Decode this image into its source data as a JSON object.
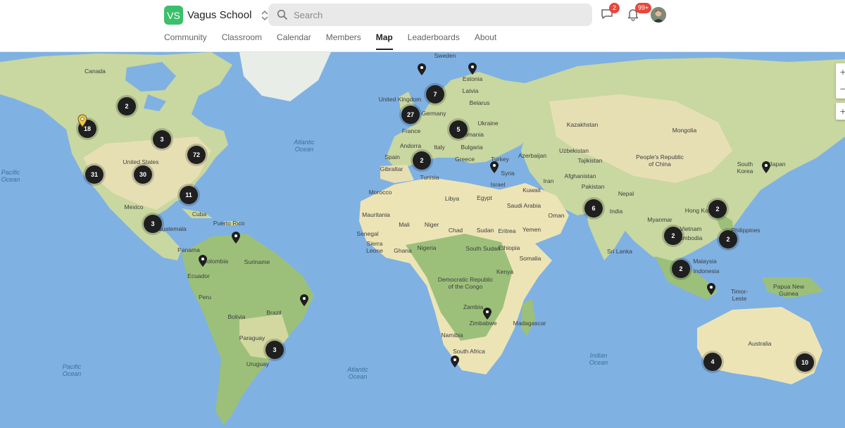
{
  "brand": {
    "initials": "VS",
    "name": "Vagus School"
  },
  "search": {
    "placeholder": "Search"
  },
  "notifications": {
    "chat_count": "2",
    "alerts_count": "99+"
  },
  "nav": {
    "tabs": [
      "Community",
      "Classroom",
      "Calendar",
      "Members",
      "Map",
      "Leaderboards",
      "About"
    ],
    "active": "Map"
  },
  "map": {
    "countries": [
      "Canada",
      "United States",
      "Mexico",
      "Cuba",
      "Guatemala",
      "Puerto Rico",
      "Panama",
      "Colombia",
      "Suriname",
      "Ecuador",
      "Peru",
      "Bolivia",
      "Brazil",
      "Paraguay",
      "Uruguay",
      "Sweden",
      "Estonia",
      "Latvia",
      "Belarus",
      "United Kingdom",
      "Germany",
      "France",
      "Ukraine",
      "Romania",
      "Andorra",
      "Italy",
      "Bulgaria",
      "Spain",
      "Greece",
      "Gibraltar",
      "Turkey",
      "Tunisia",
      "Syria",
      "Israel",
      "Morocco",
      "Libya",
      "Egypt",
      "Mauritania",
      "Mali",
      "Niger",
      "Chad",
      "Sudan",
      "Eritrea",
      "Senegal",
      "Sierra Leone",
      "Ghana",
      "Nigeria",
      "South Sudan",
      "Ethiopia",
      "Somalia",
      "Kenya",
      "Democratic Republic of the Congo",
      "Zambia",
      "Zimbabwe",
      "Madagascar",
      "Namibia",
      "South Africa",
      "Kazakhstan",
      "Mongolia",
      "Uzbekistan",
      "Tajikistan",
      "People's Republic of China",
      "Azerbaijan",
      "Iran",
      "Afghanistan",
      "Pakistan",
      "Kuwait",
      "Saudi Arabia",
      "Oman",
      "Yemen",
      "Nepal",
      "India",
      "Sri Lanka",
      "Myanmar",
      "Hong Kong",
      "Vietnam",
      "Cambodia",
      "Philippines",
      "Malaysia",
      "Indonesia",
      "Timor-Leste",
      "Papua New Guinea",
      "Australia",
      "South Korea",
      "Japan"
    ],
    "oceans": [
      "Pacific Ocean",
      "Atlantic Ocean",
      "Pacific Ocean",
      "Atlantic Ocean",
      "Indian Ocean"
    ],
    "clusters": [
      "2",
      "18",
      "3",
      "72",
      "31",
      "30",
      "11",
      "3",
      "7",
      "27",
      "5",
      "2",
      "6",
      "2",
      "2",
      "2",
      "2",
      "3",
      "4",
      "10"
    ],
    "pin_count": 13,
    "highlight_pin_color": "#f2c94c",
    "cluster_color": "#1f1f1f"
  }
}
